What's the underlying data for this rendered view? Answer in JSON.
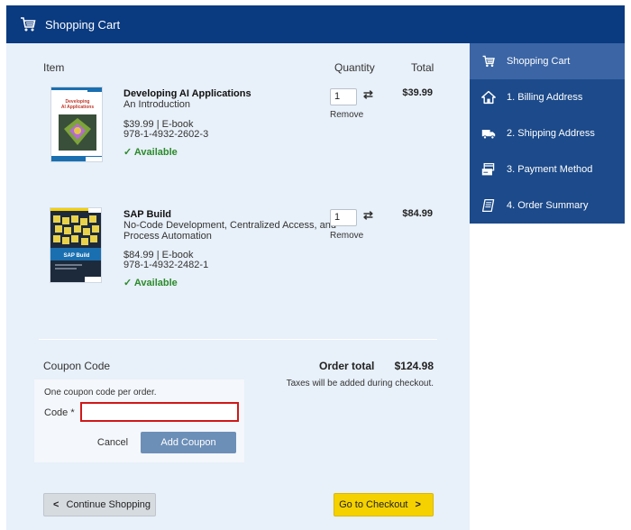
{
  "header": {
    "title": "Shopping Cart",
    "icon": "cart-icon",
    "bg_color": "#0a3a80"
  },
  "columns": {
    "item": "Item",
    "quantity": "Quantity",
    "total": "Total"
  },
  "items": [
    {
      "title": "Developing AI Applications",
      "subtitle": "An Introduction",
      "subtitle2": "",
      "price_format": "$39.99 | E-book",
      "isbn": "978-1-4932-2602-3",
      "availability": "✓ Available",
      "quantity": "1",
      "remove": "Remove",
      "total": "$39.99",
      "cover_title": "Developing AI Applications",
      "cover_subtitle": "An Introduction"
    },
    {
      "title": "SAP Build",
      "subtitle": "No-Code Development, Centralized Access, and",
      "subtitle2": "Process Automation",
      "price_format": "$84.99 | E-book",
      "isbn": "978-1-4932-2482-1",
      "availability": "✓ Available",
      "quantity": "1",
      "remove": "Remove",
      "total": "$84.99",
      "cover_title": "SAP Build",
      "cover_subtitle": ""
    }
  ],
  "coupon": {
    "title": "Coupon Code",
    "note": "One coupon code per order.",
    "code_label": "Code *",
    "code_value": "",
    "cancel": "Cancel",
    "add": "Add Coupon"
  },
  "order": {
    "total_label": "Order total",
    "total_value": "$124.98",
    "tax_note": "Taxes will be added during checkout."
  },
  "buttons": {
    "continue": "Continue Shopping",
    "continue_icon": "<",
    "checkout": "Go to Checkout",
    "checkout_icon": ">"
  },
  "sidebar": {
    "items": [
      {
        "label": "Shopping Cart",
        "icon": "cart-icon",
        "active": true
      },
      {
        "label": "1. Billing Address",
        "icon": "house-icon",
        "active": false
      },
      {
        "label": "2. Shipping Address",
        "icon": "truck-icon",
        "active": false
      },
      {
        "label": "3. Payment Method",
        "icon": "payment-icon",
        "active": false
      },
      {
        "label": "4. Order Summary",
        "icon": "receipt-icon",
        "active": false
      }
    ]
  },
  "colors": {
    "header": "#0a3a80",
    "sidebar": "#1c4a8a",
    "sidebar_active": "#3b65a5",
    "main_bg": "#e8f0f9",
    "checkout": "#f5d100",
    "add_coupon": "#6c8fb8",
    "error_border": "#d01818",
    "available": "#2a8a2a"
  }
}
